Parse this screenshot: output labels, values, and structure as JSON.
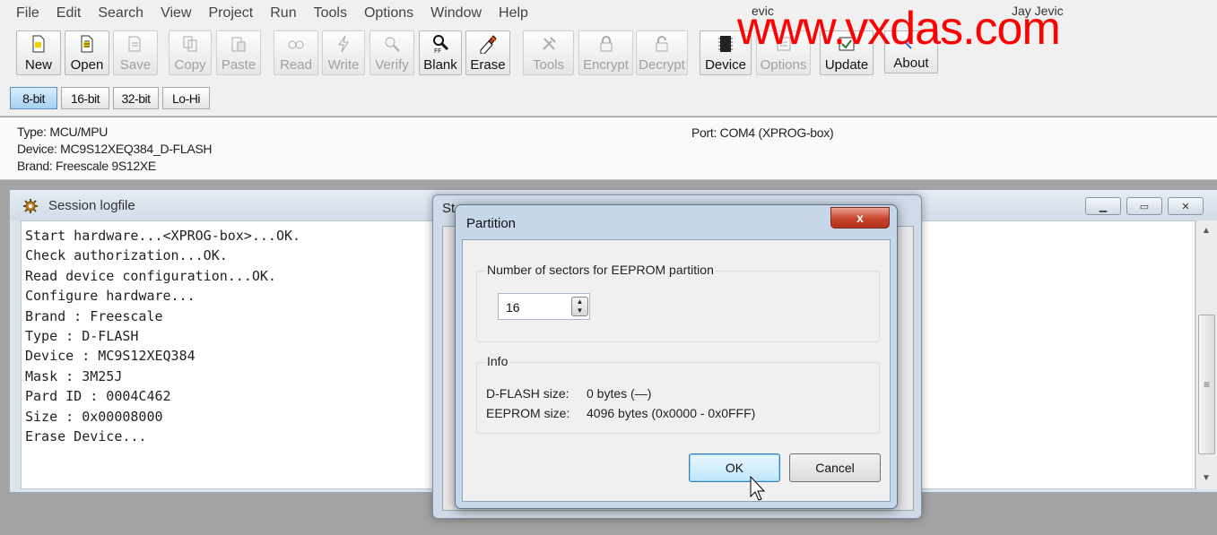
{
  "menu": [
    "File",
    "Edit",
    "Search",
    "View",
    "Project",
    "Run",
    "Tools",
    "Options",
    "Window",
    "Help"
  ],
  "toolbar": {
    "buttons": [
      {
        "label": "New",
        "icon": "new-file-icon",
        "enabled": true
      },
      {
        "label": "Open",
        "icon": "open-file-icon",
        "enabled": true
      },
      {
        "label": "Save",
        "icon": "save-icon",
        "enabled": false
      },
      {
        "label": "Copy",
        "icon": "copy-icon",
        "enabled": false
      },
      {
        "label": "Paste",
        "icon": "paste-icon",
        "enabled": false
      },
      {
        "label": "Read",
        "icon": "read-icon",
        "enabled": false
      },
      {
        "label": "Write",
        "icon": "write-icon",
        "enabled": false
      },
      {
        "label": "Verify",
        "icon": "verify-icon",
        "enabled": false
      },
      {
        "label": "Blank",
        "icon": "blank-check-icon",
        "enabled": true
      },
      {
        "label": "Erase",
        "icon": "erase-icon",
        "enabled": true
      },
      {
        "label": "Tools",
        "icon": "tools-icon",
        "enabled": false
      },
      {
        "label": "Encrypt",
        "icon": "lock-icon",
        "enabled": false
      },
      {
        "label": "Decrypt",
        "icon": "unlock-icon",
        "enabled": false
      },
      {
        "label": "Device",
        "icon": "chip-icon",
        "enabled": true
      },
      {
        "label": "Options",
        "icon": "options-icon",
        "enabled": false
      },
      {
        "label": "Update",
        "icon": "update-icon",
        "enabled": true
      },
      {
        "label": "About",
        "icon": "about-icon",
        "enabled": true
      }
    ]
  },
  "watermark": {
    "text": "www.vxdas.com",
    "small_left": "evic",
    "small_right": "Jay Jevic",
    "color": "#ff0000"
  },
  "modes": [
    {
      "label": "8-bit",
      "active": true
    },
    {
      "label": "16-bit",
      "active": false
    },
    {
      "label": "32-bit",
      "active": false
    },
    {
      "label": "Lo-Hi",
      "active": false
    }
  ],
  "info": {
    "type": "Type: MCU/MPU",
    "device": "Device: MC9S12XEQ384_D-FLASH",
    "brand": "Brand: Freescale 9S12XE",
    "port": "Port: COM4 (XPROG-box)"
  },
  "logwindow": {
    "title": "Session logfile",
    "lines": [
      "Start hardware...<XPROG-box>...OK.",
      "Check authorization...OK.",
      "Read device configuration...OK.",
      "Configure hardware...",
      "Brand : Freescale",
      "Type : D-FLASH",
      "Device : MC9S12XEQ384",
      "Mask : 3M25J",
      "Pard ID : 0004C462",
      "Size : 0x00008000",
      "Erase Device..."
    ]
  },
  "status_window": {
    "title": "St"
  },
  "dialog": {
    "title": "Partition",
    "close_label": "x",
    "sectors_group_label": "Number of sectors for EEPROM partition",
    "sectors_value": "16",
    "info_group_label": "Info",
    "dflash_key": "D-FLASH size:",
    "dflash_value": "0 bytes (—)",
    "eeprom_key": "EEPROM size:",
    "eeprom_value": "4096 bytes (0x0000 - 0x0FFF)",
    "ok_label": "OK",
    "cancel_label": "Cancel"
  }
}
